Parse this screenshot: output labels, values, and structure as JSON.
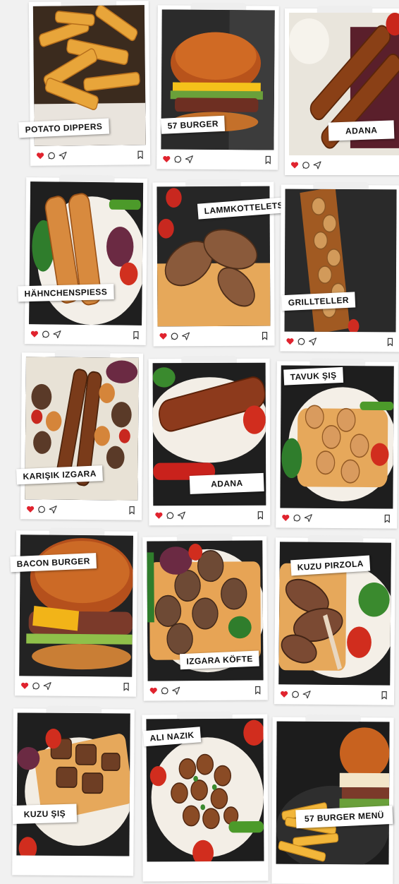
{
  "menu_items": [
    {
      "label": "POTATO DIPPERS"
    },
    {
      "label": "57 BURGER"
    },
    {
      "label": "ADANA"
    },
    {
      "label": "HÄHNCHENSPIESS"
    },
    {
      "label": "LAMMKOTTELETS"
    },
    {
      "label": "GRILLTELLER"
    },
    {
      "label": "KARIŞIK IZGARA"
    },
    {
      "label": "ADANA"
    },
    {
      "label": "TAVUK ŞIŞ"
    },
    {
      "label": "BACON BURGER"
    },
    {
      "label": "IZGARA KÖFTE"
    },
    {
      "label": "KUZU PIRZOLA"
    },
    {
      "label": "KUZU ŞIŞ"
    },
    {
      "label": "ALI NAZIK"
    },
    {
      "label": "57 BURGER  MENÜ"
    }
  ],
  "icons": [
    "heart-icon",
    "comment-icon",
    "send-icon",
    "bookmark-icon"
  ],
  "colors": {
    "heart": "#e0232e",
    "background": "#f1f1f1",
    "card": "#ffffff"
  }
}
